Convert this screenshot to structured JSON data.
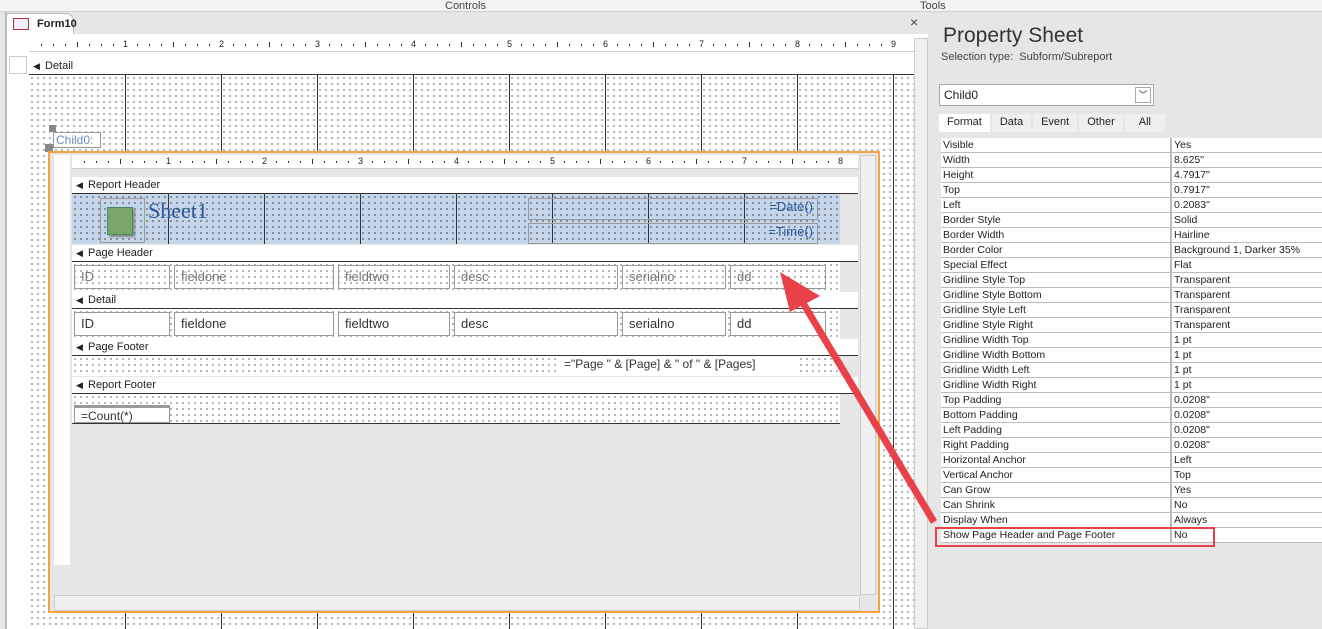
{
  "ribbon": {
    "controls": "Controls",
    "tools": "Tools"
  },
  "document": {
    "tab_title": "Form10",
    "close": "×"
  },
  "form": {
    "ruler_marks": [
      "1",
      "2",
      "3",
      "4",
      "5",
      "6",
      "7",
      "8",
      "9"
    ],
    "detail_section": "Detail",
    "subform_label": "Child0:"
  },
  "subreport": {
    "ruler_marks": [
      "1",
      "2",
      "3",
      "4",
      "5",
      "6",
      "7",
      "8"
    ],
    "sections": {
      "report_header": "Report Header",
      "page_header": "Page Header",
      "detail": "Detail",
      "page_footer": "Page Footer",
      "report_footer": "Report Footer"
    },
    "title": "Sheet1",
    "date_expr": "=Date()",
    "time_expr": "=Time()",
    "header_labels": [
      "ID",
      "fieldone",
      "fieldtwo",
      "desc",
      "serialno",
      "dd"
    ],
    "detail_fields": [
      "ID",
      "fieldone",
      "fieldtwo",
      "desc",
      "serialno",
      "dd"
    ],
    "page_expr": "=\"Page \" & [Page] & \" of \" & [Pages]",
    "count_expr": "=Count(*)"
  },
  "property_sheet": {
    "title": "Property Sheet",
    "selection_label": "Selection type:",
    "selection_type": "Subform/Subreport",
    "object": "Child0",
    "tabs": [
      "Format",
      "Data",
      "Event",
      "Other",
      "All"
    ],
    "properties": [
      {
        "name": "Visible",
        "value": "Yes"
      },
      {
        "name": "Width",
        "value": "8.625\""
      },
      {
        "name": "Height",
        "value": "4.7917\""
      },
      {
        "name": "Top",
        "value": "0.7917\""
      },
      {
        "name": "Left",
        "value": "0.2083\""
      },
      {
        "name": "Border Style",
        "value": "Solid"
      },
      {
        "name": "Border Width",
        "value": "Hairline"
      },
      {
        "name": "Border Color",
        "value": "Background 1, Darker 35%"
      },
      {
        "name": "Special Effect",
        "value": "Flat"
      },
      {
        "name": "Gridline Style Top",
        "value": "Transparent"
      },
      {
        "name": "Gridline Style Bottom",
        "value": "Transparent"
      },
      {
        "name": "Gridline Style Left",
        "value": "Transparent"
      },
      {
        "name": "Gridline Style Right",
        "value": "Transparent"
      },
      {
        "name": "Gridline Width Top",
        "value": "1 pt"
      },
      {
        "name": "Gridline Width Bottom",
        "value": "1 pt"
      },
      {
        "name": "Gridline Width Left",
        "value": "1 pt"
      },
      {
        "name": "Gridline Width Right",
        "value": "1 pt"
      },
      {
        "name": "Top Padding",
        "value": "0.0208\""
      },
      {
        "name": "Bottom Padding",
        "value": "0.0208\""
      },
      {
        "name": "Left Padding",
        "value": "0.0208\""
      },
      {
        "name": "Right Padding",
        "value": "0.0208\""
      },
      {
        "name": "Horizontal Anchor",
        "value": "Left"
      },
      {
        "name": "Vertical Anchor",
        "value": "Top"
      },
      {
        "name": "Can Grow",
        "value": "Yes"
      },
      {
        "name": "Can Shrink",
        "value": "No"
      },
      {
        "name": "Display When",
        "value": "Always"
      },
      {
        "name": "Show Page Header and Page Footer",
        "value": "No"
      }
    ]
  },
  "colors": {
    "accent_orange": "#f5a340",
    "annotation_red": "#e8414a",
    "selection_blue": "#c5d6ea"
  }
}
